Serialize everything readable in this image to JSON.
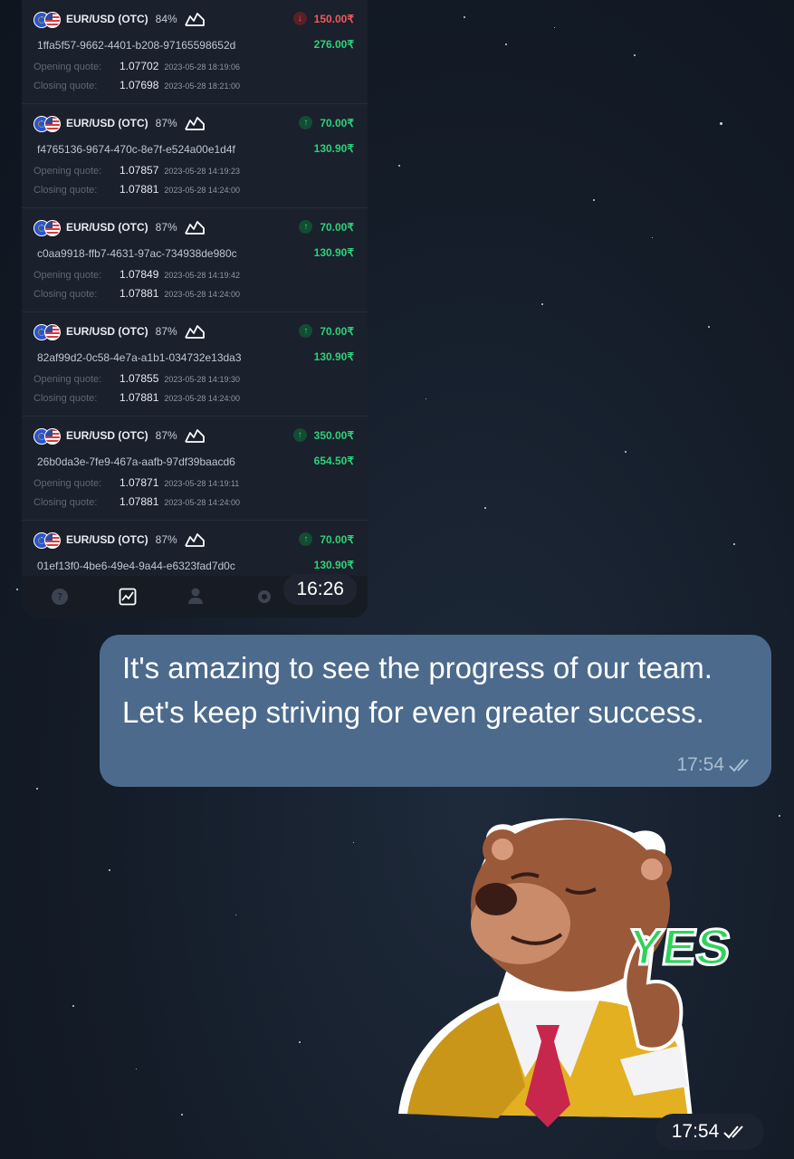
{
  "trades": [
    {
      "pair": "EUR/USD (OTC)",
      "percent": "84%",
      "id": "1ffa5f57-9662-4401-b208-97165598652d",
      "amount": "150.00₹",
      "payout": "276.00₹",
      "direction": "down",
      "opening_label": "Opening quote:",
      "opening_quote": "1.07702",
      "opening_time": "2023-05-28 18:19:06",
      "closing_label": "Closing quote:",
      "closing_quote": "1.07698",
      "closing_time": "2023-05-28 18:21:00"
    },
    {
      "pair": "EUR/USD (OTC)",
      "percent": "87%",
      "id": "f4765136-9674-470c-8e7f-e524a00e1d4f",
      "amount": "70.00₹",
      "payout": "130.90₹",
      "direction": "up",
      "opening_label": "Opening quote:",
      "opening_quote": "1.07857",
      "opening_time": "2023-05-28 14:19:23",
      "closing_label": "Closing quote:",
      "closing_quote": "1.07881",
      "closing_time": "2023-05-28 14:24:00"
    },
    {
      "pair": "EUR/USD (OTC)",
      "percent": "87%",
      "id": "c0aa9918-ffb7-4631-97ac-734938de980c",
      "amount": "70.00₹",
      "payout": "130.90₹",
      "direction": "up",
      "opening_label": "Opening quote:",
      "opening_quote": "1.07849",
      "opening_time": "2023-05-28 14:19:42",
      "closing_label": "Closing quote:",
      "closing_quote": "1.07881",
      "closing_time": "2023-05-28 14:24:00"
    },
    {
      "pair": "EUR/USD (OTC)",
      "percent": "87%",
      "id": "82af99d2-0c58-4e7a-a1b1-034732e13da3",
      "amount": "70.00₹",
      "payout": "130.90₹",
      "direction": "up",
      "opening_label": "Opening quote:",
      "opening_quote": "1.07855",
      "opening_time": "2023-05-28 14:19:30",
      "closing_label": "Closing quote:",
      "closing_quote": "1.07881",
      "closing_time": "2023-05-28 14:24:00"
    },
    {
      "pair": "EUR/USD (OTC)",
      "percent": "87%",
      "id": "26b0da3e-7fe9-467a-aafb-97df39baacd6",
      "amount": "350.00₹",
      "payout": "654.50₹",
      "direction": "up",
      "opening_label": "Opening quote:",
      "opening_quote": "1.07871",
      "opening_time": "2023-05-28 14:19:11",
      "closing_label": "Closing quote:",
      "closing_quote": "1.07881",
      "closing_time": "2023-05-28 14:24:00"
    },
    {
      "pair": "EUR/USD (OTC)",
      "percent": "87%",
      "id": "01ef13f0-4be6-49e4-9a44-e6323fad7d0c",
      "amount": "70.00₹",
      "payout": "130.90₹",
      "direction": "up",
      "opening_label": "",
      "opening_quote": "",
      "opening_time": "",
      "closing_label": "",
      "closing_quote": "",
      "closing_time": ""
    }
  ],
  "screenshot_time": "16:26",
  "message": {
    "text": "It's amazing to see the progress of our team. Let's keep striving for even greater success.",
    "time": "17:54"
  },
  "sticker": {
    "text": "YES",
    "time": "17:54"
  },
  "colors": {
    "bubble": "#4b6a8c",
    "profit": "#2ed178",
    "loss": "#ef5a5a"
  }
}
